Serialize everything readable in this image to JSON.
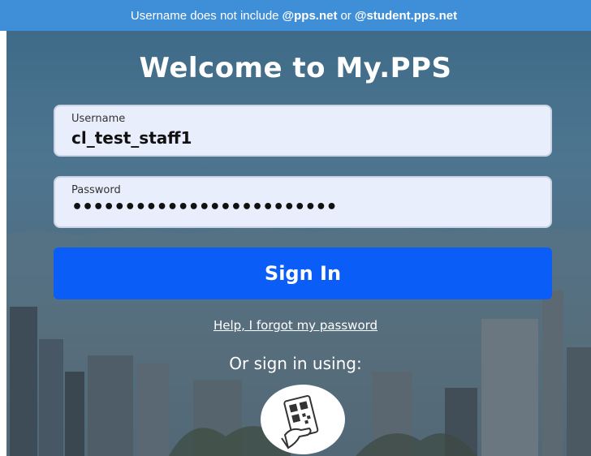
{
  "banner": {
    "prefix": "Username does not include",
    "domain1": "@pps.net",
    "conjunction": "or",
    "domain2": "@student.pps.net"
  },
  "title": "Welcome to My.PPS",
  "username": {
    "label": "Username",
    "value": "cl_test_staff1"
  },
  "password": {
    "label": "Password",
    "masked_value": "•••••••••••••••••••••••••"
  },
  "signin_label": "Sign In",
  "forgot_link": "Help, I forgot my password",
  "alt_signin": {
    "label": "Or sign in using:",
    "icon": "qr-code-card-icon"
  },
  "colors": {
    "banner": "#3f8fd8",
    "signin_button": "#0a5ef7",
    "field_bg": "#e9eefc"
  }
}
